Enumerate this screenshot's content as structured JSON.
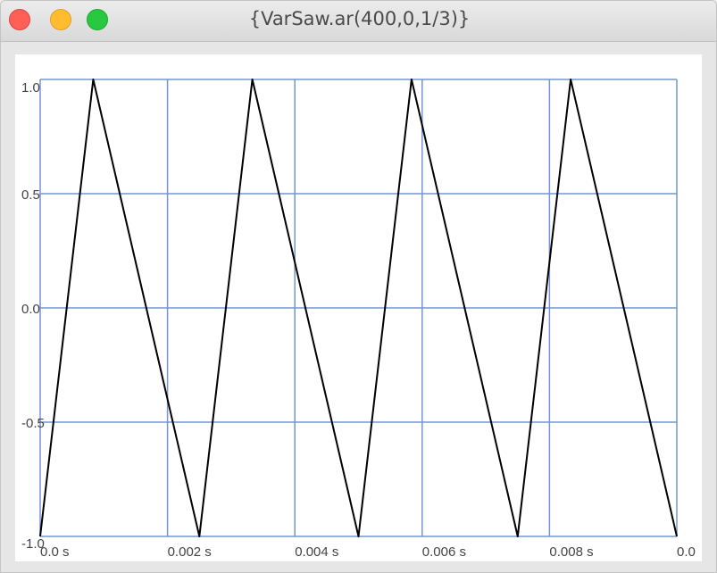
{
  "window": {
    "title": "{VarSaw.ar(400,0,1/3)}"
  },
  "colors": {
    "grid": "#7395cf",
    "trace": "#000000",
    "plot_background": "#ffffff",
    "window_background": "#e6e6e6"
  },
  "chart_data": {
    "type": "line",
    "title": "",
    "xlabel": "",
    "ylabel": "",
    "xlim": [
      0,
      0.01
    ],
    "ylim": [
      -1,
      1
    ],
    "grid": true,
    "x_ticks": [
      {
        "value": 0,
        "label": "0.0 s"
      },
      {
        "value": 0.002,
        "label": "0.002 s"
      },
      {
        "value": 0.004,
        "label": "0.004 s"
      },
      {
        "value": 0.006,
        "label": "0.006 s"
      },
      {
        "value": 0.008,
        "label": "0.008 s"
      },
      {
        "value": 0.01,
        "label": "0.0"
      }
    ],
    "y_ticks": [
      {
        "value": 1,
        "label": "1.0"
      },
      {
        "value": 0.5,
        "label": "0.5"
      },
      {
        "value": 0,
        "label": "0.0"
      },
      {
        "value": -0.5,
        "label": "-0.5"
      },
      {
        "value": -1,
        "label": "-1.0"
      }
    ],
    "series": [
      {
        "color": "#000000",
        "x": [
          0,
          0.000833,
          0.0025,
          0.003333,
          0.005,
          0.005833,
          0.0075,
          0.008333,
          0.01
        ],
        "y": [
          -1,
          1,
          -1,
          1,
          -1,
          1,
          -1,
          1,
          -1
        ]
      }
    ]
  }
}
